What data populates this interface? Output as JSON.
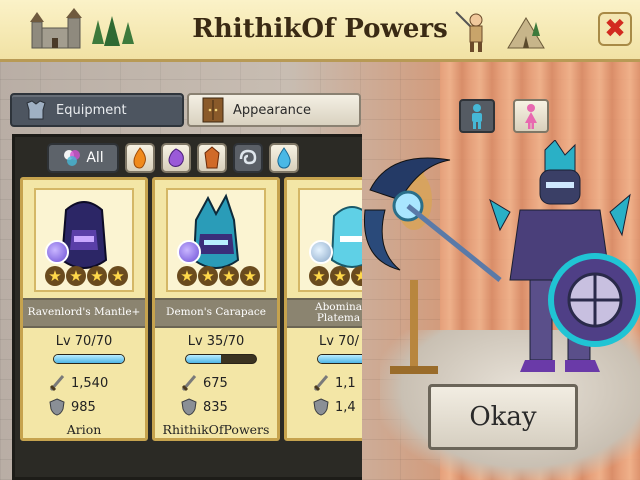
{
  "header": {
    "title": "RhithikOf Powers"
  },
  "tabs": [
    {
      "label": "Equipment",
      "active": false
    },
    {
      "label": "Appearance",
      "active": true
    }
  ],
  "filters": {
    "all_label": "All",
    "icons": [
      "fire-element-icon",
      "shadow-element-icon",
      "earth-element-icon",
      "air-element-icon",
      "water-element-icon"
    ]
  },
  "cards": [
    {
      "name": "Ravenlord's Mantle+",
      "level": "Lv 70/70",
      "level_fraction": 1.0,
      "attack": "1,540",
      "defense": "985",
      "owner": "Arion",
      "stars": 4,
      "element": "shadow"
    },
    {
      "name": "Demon's Carapace",
      "level": "Lv 35/70",
      "level_fraction": 0.5,
      "attack": "675",
      "defense": "835",
      "owner": "RhithikOfPowers",
      "stars": 4,
      "element": "shadow"
    },
    {
      "name": "Abomina\nPlatema",
      "level": "Lv 70/",
      "level_fraction": 1.0,
      "attack": "1,1",
      "defense": "1,4",
      "owner": "",
      "stars": 3,
      "element": "air"
    }
  ],
  "okay_label": "Okay",
  "colors": {
    "accent": "#c6a34e",
    "close": "#d22a20",
    "bar_fill": "#4fb6e6"
  }
}
